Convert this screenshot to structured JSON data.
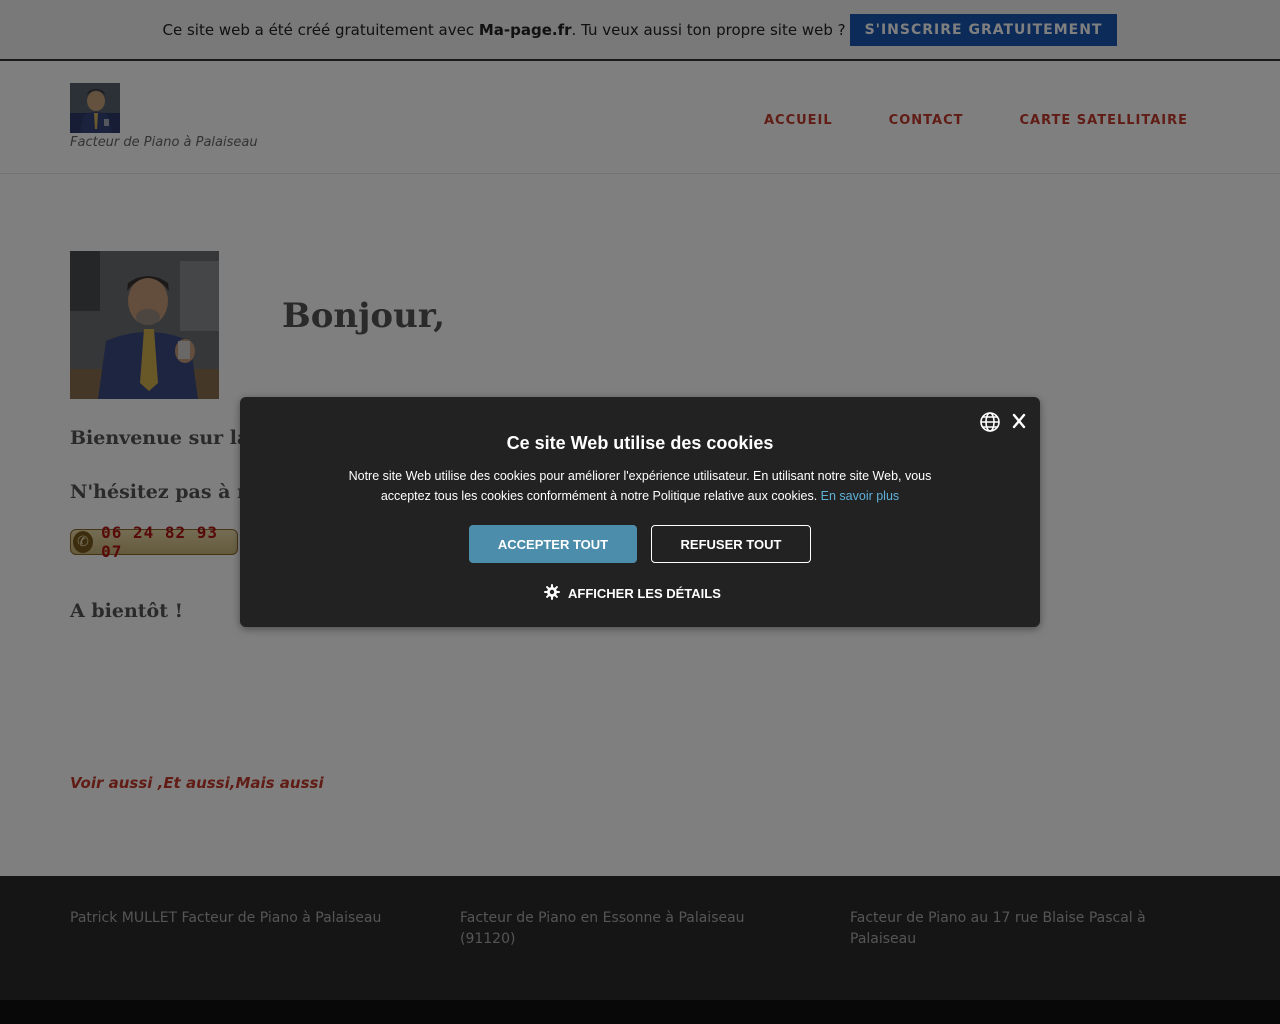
{
  "promo": {
    "text_before": "Ce site web a été créé gratuitement avec ",
    "brand": "Ma-page.fr",
    "text_after": ". Tu veux aussi ton propre site web ?",
    "cta": "S'INSCRIRE GRATUITEMENT"
  },
  "header": {
    "tagline": "Facteur de Piano à Palaiseau",
    "nav": [
      "ACCUEIL",
      "CONTACT",
      "CARTE SATELLITAIRE"
    ]
  },
  "main": {
    "heading": "Bonjour,",
    "welcome": "Bienvenue sur la",
    "contact_line": "N'hésitez pas à n",
    "phone": "06 24 82 93 07",
    "closing": "A bientôt !",
    "links": [
      "Voir aussi ",
      "Et aussi",
      "Mais aussi"
    ],
    "link_separators": [
      ",",
      ","
    ]
  },
  "footer": {
    "col1": "Patrick MULLET Facteur de Piano à Palaiseau",
    "col2": "Facteur de Piano en Essonne à Palaiseau (91120)",
    "col3": "Facteur de Piano au 17 rue Blaise Pascal à Palaiseau"
  },
  "cookie": {
    "title": "Ce site Web utilise des cookies",
    "body": "Notre site Web utilise des cookies pour améliorer l'expérience utilisateur. En utilisant notre site Web, vous acceptez tous les cookies conformément à notre Politique relative aux cookies.",
    "learn_more": "En savoir plus",
    "accept": "ACCEPTER TOUT",
    "refuse": "REFUSER TOUT",
    "details": "AFFICHER LES DÉTAILS"
  },
  "colors": {
    "accent_red": "#c0392b",
    "promo_button": "#1a56b0",
    "accept_button": "#4c8dab",
    "modal_bg": "#222222",
    "footer_bg": "#2a2a2a"
  },
  "icons": [
    "phone-icon",
    "globe-icon",
    "close-icon",
    "gear-icon"
  ]
}
